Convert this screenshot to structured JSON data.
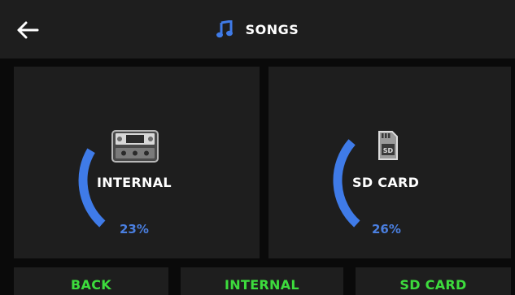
{
  "header": {
    "title": "SONGS",
    "back_icon": "arrow-left-icon",
    "title_icon": "music-note-icon"
  },
  "storage": [
    {
      "id": "internal",
      "label": "INTERNAL",
      "percent_text": "23%",
      "usage_fraction": 0.23,
      "icon": "device-icon"
    },
    {
      "id": "sd",
      "label": "SD CARD",
      "percent_text": "26%",
      "usage_fraction": 0.26,
      "icon": "sd-card-icon"
    }
  ],
  "softkeys": {
    "back": "BACK",
    "internal": "INTERNAL",
    "sd": "SD CARD"
  },
  "colors": {
    "accent_blue": "#3f7be8",
    "softkey_green": "#3ddc3d",
    "panel": "#1e1e1e",
    "background": "#0a0a0a"
  }
}
